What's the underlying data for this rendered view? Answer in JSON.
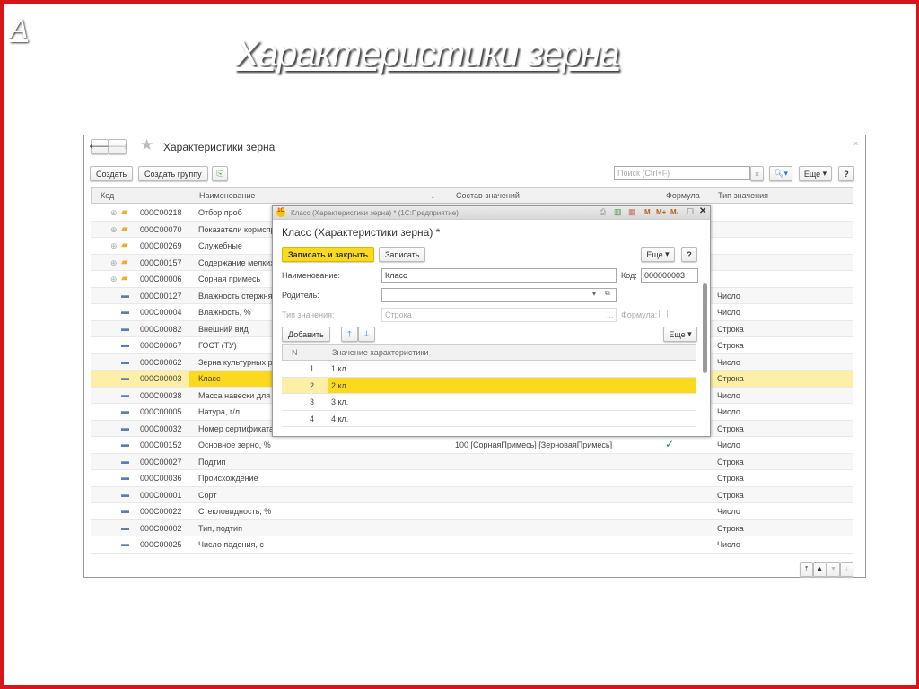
{
  "slide": {
    "corner_label": "А",
    "title": "Характеристики зерна",
    "border_color": "#d6161b"
  },
  "window": {
    "title": "Характеристики зерна",
    "back_icon": "arrow-left",
    "forward_icon": "arrow-right",
    "favorite_icon": "star",
    "close": "×"
  },
  "toolbar": {
    "create": "Создать",
    "create_group": "Создать группу",
    "search_placeholder": "Поиск (Ctrl+F)",
    "search_clear": "×",
    "more": "Еще",
    "help": "?"
  },
  "table": {
    "columns": [
      "Код",
      "Наименование",
      "Состав значений",
      "Формула",
      "Тип значения"
    ],
    "sort_indicator": "↓",
    "rows": [
      {
        "folder": true,
        "code": "000С00218",
        "name": "Отбор проб",
        "composition": "",
        "formula": false,
        "type": ""
      },
      {
        "folder": true,
        "code": "000С00070",
        "name": "Показатели кормспр",
        "composition": "",
        "formula": false,
        "type": ""
      },
      {
        "folder": true,
        "code": "000С00269",
        "name": "Служебные",
        "composition": "",
        "formula": false,
        "type": ""
      },
      {
        "folder": true,
        "code": "000С00157",
        "name": "Содержание мелких",
        "composition": "",
        "formula": false,
        "type": ""
      },
      {
        "folder": true,
        "code": "000С00006",
        "name": "Сорная примесь",
        "composition": "",
        "formula": false,
        "type": ""
      },
      {
        "folder": false,
        "code": "000С00127",
        "name": "Влажность стержня,",
        "composition": "",
        "formula": false,
        "type": "Число"
      },
      {
        "folder": false,
        "code": "000С00004",
        "name": "Влажность, %",
        "composition": "",
        "formula": false,
        "type": "Число"
      },
      {
        "folder": false,
        "code": "000С00082",
        "name": "Внешний вид",
        "composition": "",
        "formula": false,
        "type": "Строка"
      },
      {
        "folder": false,
        "code": "000С00067",
        "name": "ГОСТ (ТУ)",
        "composition": "",
        "formula": false,
        "type": "Строка"
      },
      {
        "folder": false,
        "code": "000С00062",
        "name": "Зерна культурных ра",
        "composition": "",
        "formula": false,
        "type": "Число"
      },
      {
        "folder": false,
        "code": "000С00003",
        "name": "Класс",
        "composition": "",
        "formula": false,
        "type": "Строка",
        "selected": true
      },
      {
        "folder": false,
        "code": "000С00038",
        "name": "Масса навески для с",
        "composition": "",
        "formula": false,
        "type": "Число"
      },
      {
        "folder": false,
        "code": "000С00005",
        "name": "Натура, г/л",
        "composition": "",
        "formula": false,
        "type": "Число"
      },
      {
        "folder": false,
        "code": "000С00032",
        "name": "Номер сертификата (",
        "composition": "",
        "formula": false,
        "type": "Строка"
      },
      {
        "folder": false,
        "code": "000С00152",
        "name": "Основное зерно, %",
        "composition": "100 [СорнаяПримесь] [ЗерноваяПримесь]",
        "formula": true,
        "type": "Число"
      },
      {
        "folder": false,
        "code": "000С00027",
        "name": "Подтип",
        "composition": "",
        "formula": false,
        "type": "Строка"
      },
      {
        "folder": false,
        "code": "000С00036",
        "name": "Происхождение",
        "composition": "",
        "formula": false,
        "type": "Строка"
      },
      {
        "folder": false,
        "code": "000С00001",
        "name": "Сорт",
        "composition": "",
        "formula": false,
        "type": "Строка"
      },
      {
        "folder": false,
        "code": "000С00022",
        "name": "Стекловидность, %",
        "composition": "",
        "formula": false,
        "type": "Число"
      },
      {
        "folder": false,
        "code": "000С00002",
        "name": "Тип, подтип",
        "composition": "",
        "formula": false,
        "type": "Строка"
      },
      {
        "folder": false,
        "code": "000С00025",
        "name": "Число падения, с",
        "composition": "",
        "formula": false,
        "type": "Число"
      }
    ]
  },
  "modal": {
    "window_title": "Класс (Характеристики зерна) * (1С:Предприятие)",
    "title_tools": [
      "M",
      "M+",
      "M-"
    ],
    "heading": "Класс (Характеристики зерна) *",
    "save_close": "Записать и закрыть",
    "save": "Записать",
    "more": "Еще",
    "help": "?",
    "name_label": "Наименование:",
    "name_value": "Класс",
    "code_label": "Код:",
    "code_value": "000000003",
    "parent_label": "Родитель:",
    "parent_value": "",
    "type_label": "Тип значения:",
    "type_value": "Строка",
    "type_btn": "...",
    "formula_label": "Формула:",
    "add": "Добавить",
    "more2": "Еще",
    "grid_columns": [
      "N",
      "Значение характеристики"
    ],
    "grid_rows": [
      {
        "n": "1",
        "value": "1 кл."
      },
      {
        "n": "2",
        "value": "2 кл.",
        "selected": true
      },
      {
        "n": "3",
        "value": "3 кл."
      },
      {
        "n": "4",
        "value": "4 кл."
      }
    ]
  },
  "colors": {
    "accent": "#fbd91f",
    "selected_row": "#fdefa5",
    "check": "#1a9a4a"
  }
}
